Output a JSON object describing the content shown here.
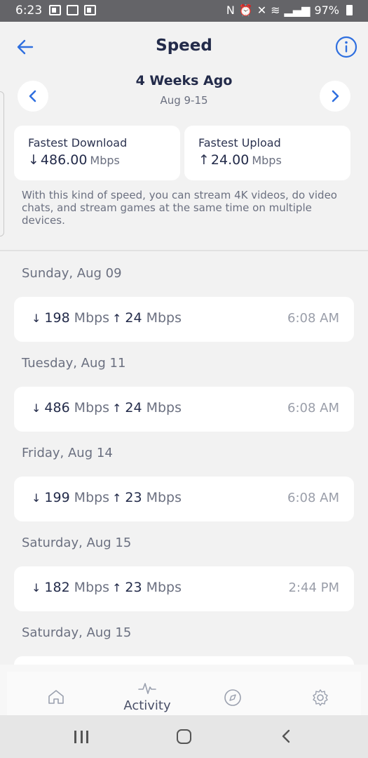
{
  "status_bar": {
    "time": "6:23",
    "battery": "97%"
  },
  "header": {
    "title": "Speed",
    "period_title": "4 Weeks Ago",
    "period_range": "Aug 9-15"
  },
  "stats": {
    "download": {
      "label": "Fastest Download",
      "value": "486.00",
      "unit": "Mbps"
    },
    "upload": {
      "label": "Fastest Upload",
      "value": "24.00",
      "unit": "Mbps"
    },
    "description": "With this kind of speed, you can stream 4K videos, do video chats, and stream games at the same time on multiple devices."
  },
  "entries": [
    {
      "day": "Sunday, Aug 09",
      "download": "198",
      "upload": "24",
      "unit": "Mbps",
      "time": "6:08 AM"
    },
    {
      "day": "Tuesday, Aug 11",
      "download": "486",
      "upload": "24",
      "unit": "Mbps",
      "time": "6:08 AM"
    },
    {
      "day": "Friday, Aug 14",
      "download": "199",
      "upload": "23",
      "unit": "Mbps",
      "time": "6:08 AM"
    },
    {
      "day": "Saturday, Aug 15",
      "download": "182",
      "upload": "23",
      "unit": "Mbps",
      "time": "2:44 PM"
    },
    {
      "day": "Saturday, Aug 15"
    }
  ],
  "bottom_nav": {
    "activity_label": "Activity"
  },
  "colors": {
    "accent": "#2f6fdf",
    "text_dark": "#232b4a",
    "text_muted": "#6b7080",
    "background": "#f2f2f2"
  }
}
